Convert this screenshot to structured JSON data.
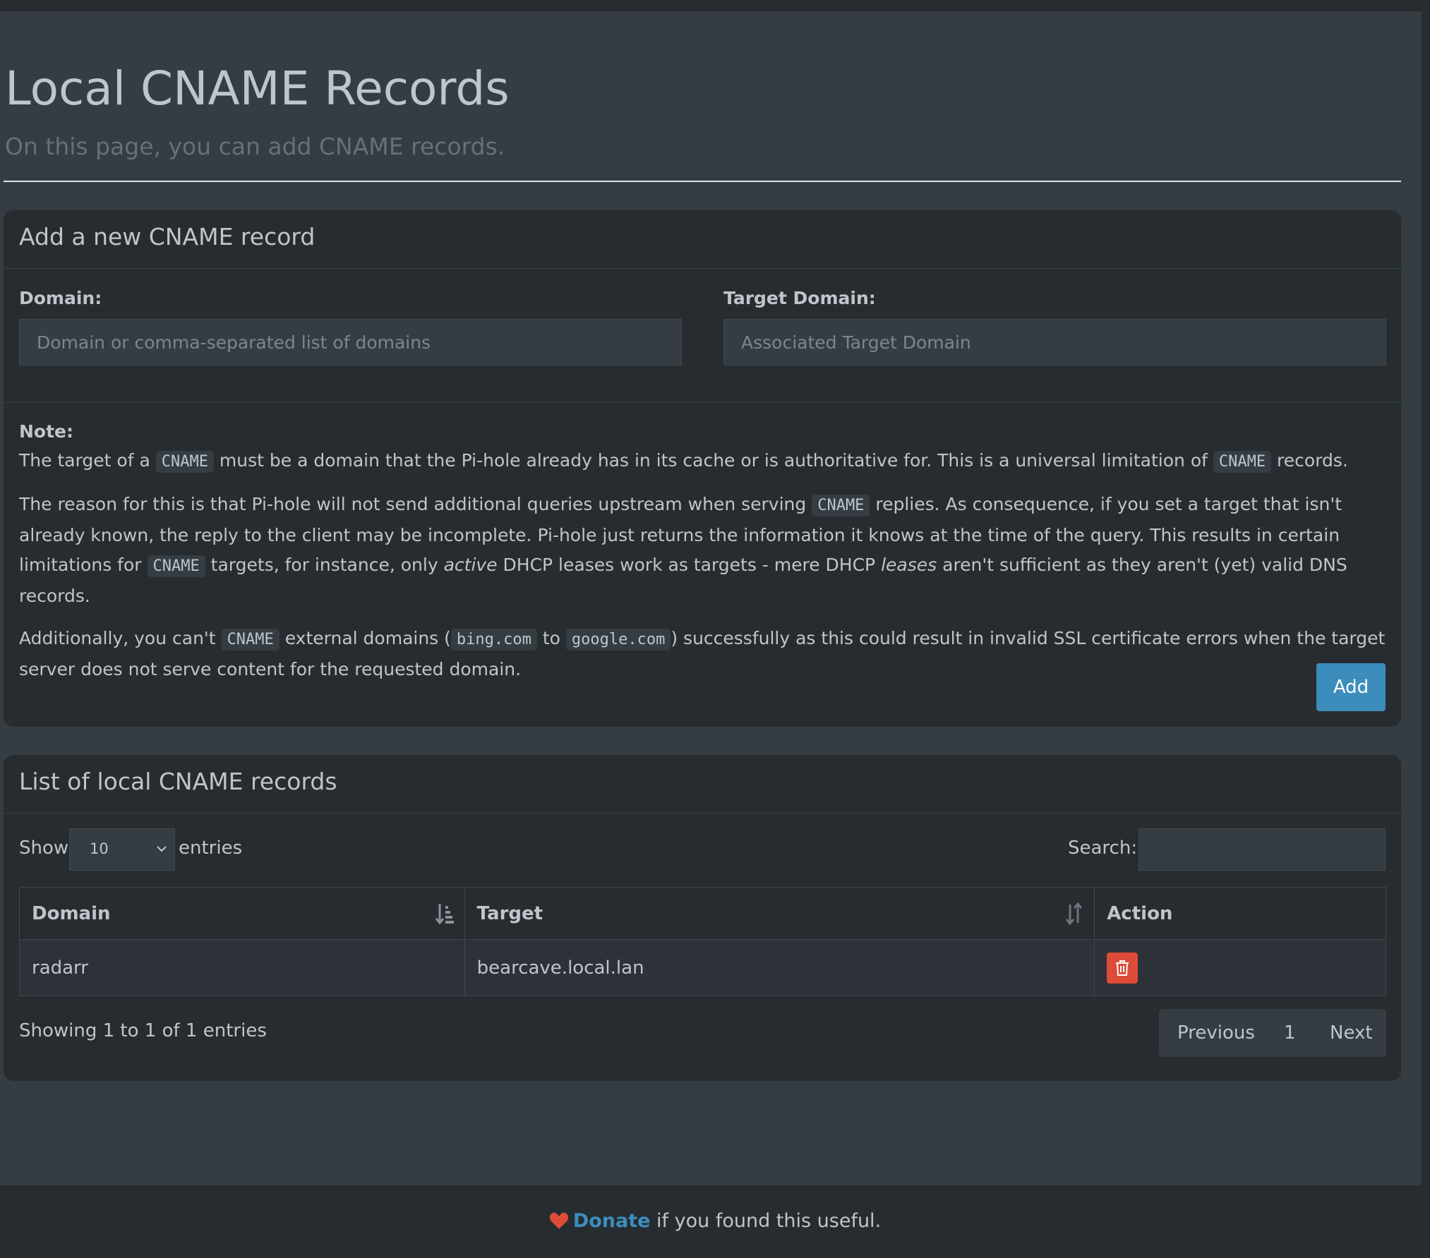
{
  "page": {
    "title": "Local CNAME Records",
    "subtitle": "On this page, you can add CNAME records."
  },
  "add_box": {
    "title": "Add a new CNAME record",
    "domain_label": "Domain:",
    "domain_placeholder": "Domain or comma-separated list of domains",
    "target_label": "Target Domain:",
    "target_placeholder": "Associated Target Domain",
    "note_title": "Note:",
    "note": {
      "p1_a": "The target of a ",
      "p1_code": "CNAME",
      "p1_b": " must be a domain that the Pi-hole already has in its cache or is authoritative for. This is a universal limitation of ",
      "p1_code2": "CNAME",
      "p1_c": " records.",
      "p2_a": "The reason for this is that Pi-hole will not send additional queries upstream when serving ",
      "p2_code": "CNAME",
      "p2_b": " replies. As consequence, if you set a target that isn't already known, the reply to the client may be incomplete. Pi-hole just returns the information it knows at the time of the query. This results in certain limitations for ",
      "p2_code2": "CNAME",
      "p2_c": " targets, for instance, only ",
      "p2_em": "active",
      "p2_d": " DHCP leases work as targets - mere DHCP ",
      "p2_em2": "leases",
      "p2_e": " aren't sufficient as they aren't (yet) valid DNS records.",
      "p3_a": "Additionally, you can't ",
      "p3_code": "CNAME",
      "p3_b": " external domains (",
      "p3_code2": "bing.com",
      "p3_c": " to ",
      "p3_code3": "google.com",
      "p3_d": ") successfully as this could result in invalid SSL certificate errors when the target server does not serve content for the requested domain."
    },
    "add_button": "Add"
  },
  "list_box": {
    "title": "List of local CNAME records",
    "show_label": "Show",
    "entries_label": "entries",
    "page_length": "10",
    "search_label": "Search:",
    "search_value": "",
    "columns": [
      "Domain",
      "Target",
      "Action"
    ],
    "rows": [
      {
        "domain": "radarr",
        "target": "bearcave.local.lan",
        "action_icon": "trash-icon"
      }
    ],
    "info": "Showing 1 to 1 of 1 entries",
    "pagination": {
      "previous": "Previous",
      "page": "1",
      "next": "Next"
    }
  },
  "footer": {
    "donate_link": "Donate",
    "donate_text": " if you found this useful."
  },
  "colors": {
    "background": "#353c42",
    "panel": "#272c30",
    "primary": "#3c8dbc",
    "danger": "#dd4b39"
  }
}
